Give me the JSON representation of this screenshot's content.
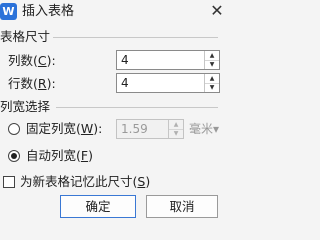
{
  "window": {
    "title": "插入表格",
    "app_icon_glyph": "W",
    "close_glyph": "✕"
  },
  "table_size": {
    "group_label": "表格尺寸",
    "columns": {
      "label": "列数(",
      "key": "C",
      "suffix": "):",
      "value": "4"
    },
    "rows": {
      "label": "行数(",
      "key": "R",
      "suffix": "):",
      "value": "4"
    }
  },
  "column_width": {
    "group_label": "列宽选择",
    "fixed": {
      "label": "固定列宽(",
      "key": "W",
      "suffix": "):",
      "value": "1.59",
      "unit": "毫米▾",
      "selected": false
    },
    "auto": {
      "label": "自动列宽(",
      "key": "F",
      "suffix": ")",
      "selected": true
    }
  },
  "remember": {
    "label": "为新表格记忆此尺寸(",
    "key": "S",
    "suffix": ")",
    "checked": false
  },
  "buttons": {
    "ok": "确定",
    "cancel": "取消"
  },
  "icons": {
    "spin_up": "▲",
    "spin_down": "▼"
  }
}
